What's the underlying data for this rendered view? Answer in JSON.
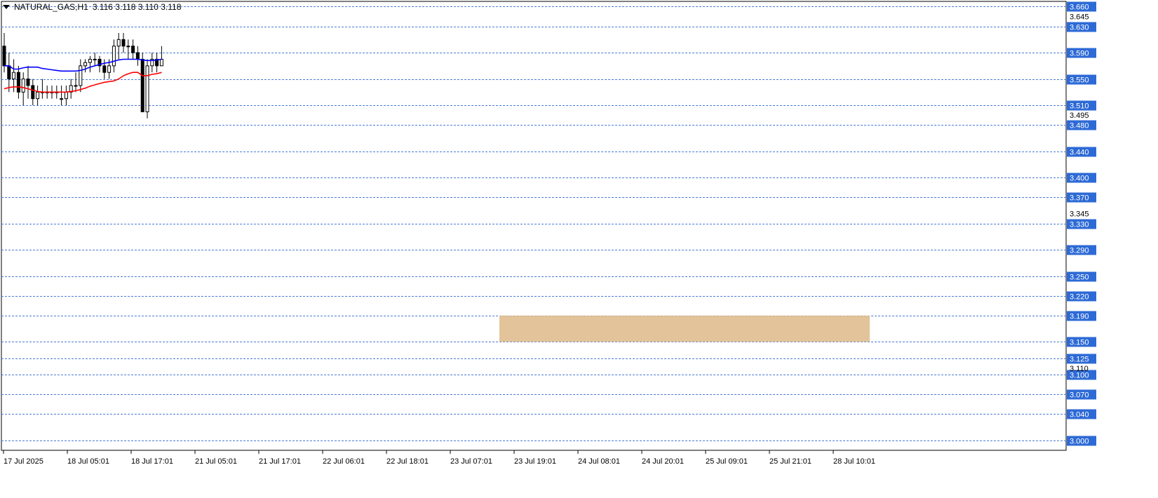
{
  "header": {
    "symbol": "NATURAL_GAS,H1",
    "ohlc": "3.116 3.118 3.110 3.118"
  },
  "colors": {
    "background": "#ffffff",
    "grid": "#4a7bd6",
    "ema_fast": "#ff0000",
    "ema_slow": "#0000ff",
    "zone": "#deb887",
    "candle_bull_body": "#ffffff",
    "candle_bear_body": "#000000",
    "price_label_bg": "#2d6ad6"
  },
  "chart_data": {
    "type": "candlestick",
    "title": "NATURAL_GAS,H1",
    "ylim": [
      2.985,
      3.668
    ],
    "grid": true,
    "price_axis": {
      "boxed_levels": [
        "3.660",
        "3.630",
        "3.590",
        "3.550",
        "3.510",
        "3.480",
        "3.440",
        "3.400",
        "3.370",
        "3.330",
        "3.290",
        "3.250",
        "3.220",
        "3.190",
        "3.150",
        "3.125",
        "3.100",
        "3.070",
        "3.040",
        "3.000"
      ],
      "minor_labels": [
        "3.645",
        "3.495",
        "3.345",
        "3.110"
      ]
    },
    "time_axis": [
      "17 Jul 2025",
      "18 Jul 05:01",
      "18 Jul 17:01",
      "21 Jul 05:01",
      "21 Jul 17:01",
      "22 Jul 06:01",
      "22 Jul 18:01",
      "23 Jul 07:01",
      "23 Jul 19:01",
      "24 Jul 08:01",
      "24 Jul 20:01",
      "25 Jul 09:01",
      "25 Jul 21:01",
      "28 Jul 10:01"
    ],
    "candles": [
      [
        3.6,
        3.62,
        3.56,
        3.57
      ],
      [
        3.57,
        3.59,
        3.53,
        3.55
      ],
      [
        3.55,
        3.58,
        3.53,
        3.56
      ],
      [
        3.56,
        3.57,
        3.52,
        3.53
      ],
      [
        3.53,
        3.56,
        3.51,
        3.55
      ],
      [
        3.55,
        3.57,
        3.52,
        3.54
      ],
      [
        3.54,
        3.55,
        3.51,
        3.52
      ],
      [
        3.52,
        3.54,
        3.51,
        3.53
      ],
      [
        3.53,
        3.55,
        3.52,
        3.53
      ],
      [
        3.53,
        3.54,
        3.52,
        3.53
      ],
      [
        3.53,
        3.54,
        3.52,
        3.53
      ],
      [
        3.53,
        3.54,
        3.52,
        3.53
      ],
      [
        3.52,
        3.54,
        3.51,
        3.52
      ],
      [
        3.52,
        3.54,
        3.51,
        3.53
      ],
      [
        3.53,
        3.55,
        3.52,
        3.54
      ],
      [
        3.54,
        3.56,
        3.53,
        3.54
      ],
      [
        3.54,
        3.58,
        3.53,
        3.57
      ],
      [
        3.57,
        3.58,
        3.56,
        3.575
      ],
      [
        3.575,
        3.585,
        3.56,
        3.58
      ],
      [
        3.58,
        3.59,
        3.57,
        3.58
      ],
      [
        3.58,
        3.585,
        3.56,
        3.57
      ],
      [
        3.57,
        3.58,
        3.55,
        3.56
      ],
      [
        3.56,
        3.58,
        3.55,
        3.57
      ],
      [
        3.57,
        3.61,
        3.56,
        3.6
      ],
      [
        3.6,
        3.62,
        3.58,
        3.61
      ],
      [
        3.61,
        3.62,
        3.59,
        3.6
      ],
      [
        3.6,
        3.61,
        3.58,
        3.6
      ],
      [
        3.6,
        3.61,
        3.58,
        3.59
      ],
      [
        3.59,
        3.6,
        3.57,
        3.58
      ],
      [
        3.58,
        3.59,
        3.55,
        3.5
      ],
      [
        3.5,
        3.58,
        3.49,
        3.57
      ],
      [
        3.57,
        3.59,
        3.56,
        3.58
      ],
      [
        3.58,
        3.59,
        3.56,
        3.57
      ],
      [
        3.57,
        3.6,
        3.57,
        3.58
      ]
    ],
    "series": [
      {
        "values": [
          3.57,
          3.57,
          3.565,
          3.565,
          3.567,
          3.568,
          3.568,
          3.568,
          3.566,
          3.565,
          3.564,
          3.563,
          3.562,
          3.562,
          3.562,
          3.562,
          3.563,
          3.565,
          3.568,
          3.57,
          3.572,
          3.574,
          3.575,
          3.577,
          3.579,
          3.58,
          3.58,
          3.58,
          3.58,
          3.579,
          3.578,
          3.578,
          3.579,
          3.58
        ]
      },
      {
        "values": [
          3.535,
          3.537,
          3.538,
          3.538,
          3.537,
          3.535,
          3.533,
          3.531,
          3.53,
          3.53,
          3.53,
          3.53,
          3.53,
          3.53,
          3.531,
          3.532,
          3.534,
          3.536,
          3.539,
          3.541,
          3.543,
          3.545,
          3.546,
          3.547,
          3.55,
          3.555,
          3.558,
          3.56,
          3.56,
          3.555,
          3.555,
          3.557,
          3.558,
          3.56
        ]
      }
    ]
  }
}
